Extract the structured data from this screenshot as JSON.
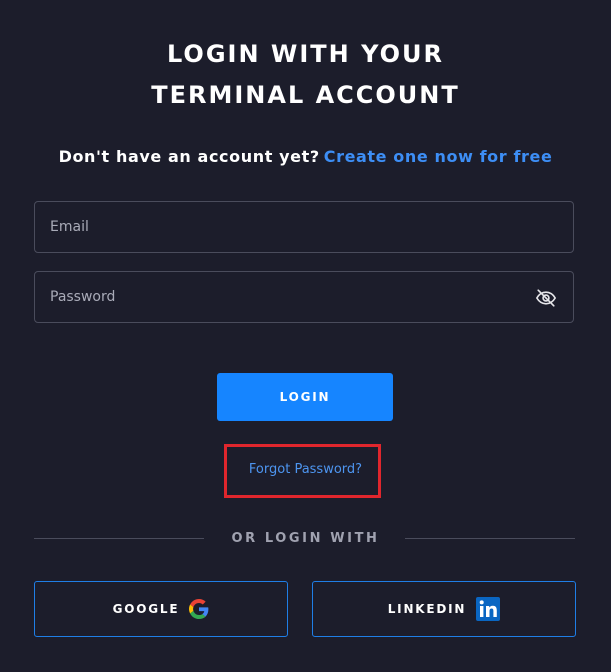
{
  "header": {
    "title_line1": "LOGIN WITH YOUR",
    "title_line2": "TERMINAL ACCOUNT"
  },
  "signup": {
    "prompt": "Don't have an account yet?",
    "link": "Create one now for free"
  },
  "form": {
    "email_placeholder": "Email",
    "password_placeholder": "Password",
    "login_label": "LOGIN",
    "forgot_label": "Forgot Password?"
  },
  "social": {
    "divider_label": "OR LOGIN WITH",
    "google_label": "GOOGLE",
    "linkedin_label": "LINKEDIN"
  },
  "icons": {
    "password_toggle": "eye-slash-icon",
    "google": "google-icon",
    "linkedin": "linkedin-icon"
  },
  "colors": {
    "background": "#1c1d2b",
    "accent": "#1685ff",
    "link": "#3d8ef5",
    "highlight": "#e0262d"
  }
}
